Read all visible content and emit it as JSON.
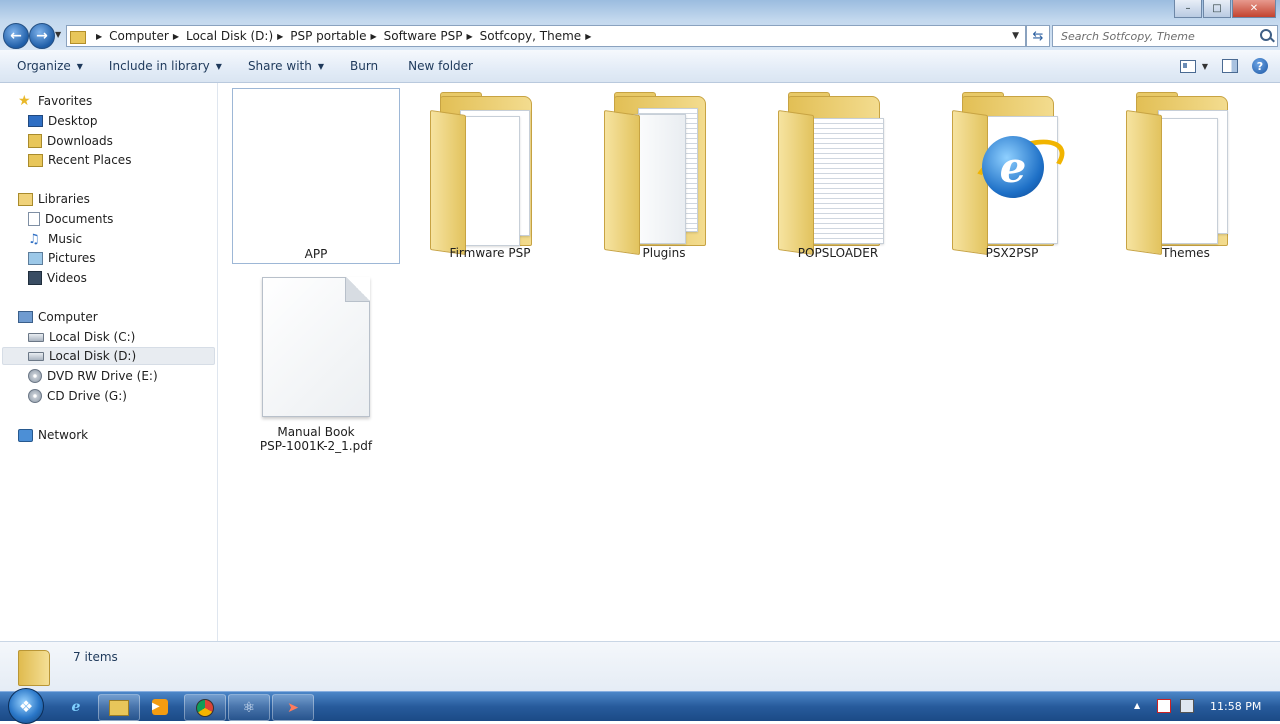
{
  "window": {
    "controls": [
      "minimize",
      "maximize",
      "close"
    ]
  },
  "address": {
    "breadcrumbs": [
      "Computer",
      "Local Disk (D:)",
      "PSP portable",
      "Software PSP",
      "Sotfcopy, Theme"
    ],
    "search_placeholder": "Search Sotfcopy, Theme"
  },
  "toolbar": {
    "organize": "Organize",
    "include_in_library": "Include in library",
    "share_with": "Share with",
    "burn": "Burn",
    "new_folder": "New folder"
  },
  "navpane": {
    "favorites": {
      "label": "Favorites",
      "items": [
        "Desktop",
        "Downloads",
        "Recent Places"
      ]
    },
    "libraries": {
      "label": "Libraries",
      "items": [
        "Documents",
        "Music",
        "Pictures",
        "Videos"
      ]
    },
    "computer": {
      "label": "Computer",
      "items": [
        "Local Disk (C:)",
        "Local Disk (D:)",
        "DVD RW Drive (E:)",
        "CD Drive (G:)"
      ],
      "selected": "Local Disk (D:)"
    },
    "network": {
      "label": "Network"
    }
  },
  "items": [
    {
      "name": "APP",
      "type": "folder-empty"
    },
    {
      "name": "Firmware PSP",
      "type": "folder"
    },
    {
      "name": "Plugins",
      "type": "folder"
    },
    {
      "name": "POPSLOADER",
      "type": "folder"
    },
    {
      "name": "PSX2PSP",
      "type": "folder"
    },
    {
      "name": "Themes",
      "type": "folder"
    },
    {
      "name_line1": "Manual Book",
      "name_line2": "PSP-1001K-2_1.pdf",
      "type": "file"
    }
  ],
  "details": {
    "count": "7 items"
  },
  "taskbar": {
    "apps": [
      "internet-explorer",
      "windows-explorer",
      "media-player",
      "chrome",
      "app-5",
      "app-6"
    ],
    "clock": "11:58 PM"
  },
  "colors": {
    "accent": "#1e395b",
    "taskbar": "#275b9c",
    "folder": "#e8c65a"
  }
}
